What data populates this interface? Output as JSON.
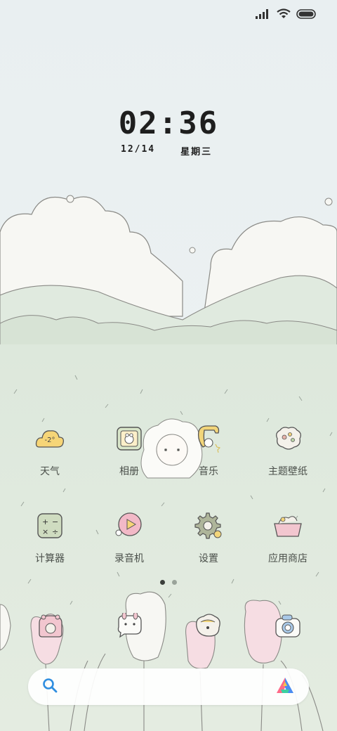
{
  "status_bar": {
    "signal_icon": "signal-bars-icon",
    "wifi_icon": "wifi-icon",
    "battery_icon": "battery-icon"
  },
  "lockscreen": {
    "time": "02:36",
    "date": "12/14",
    "weekday": "星期三"
  },
  "apps_row1": [
    {
      "label": "天气",
      "icon": "weather-cloud-icon",
      "temp": "-2°"
    },
    {
      "label": "相册",
      "icon": "gallery-icon"
    },
    {
      "label": "音乐",
      "icon": "music-icon"
    },
    {
      "label": "主题壁纸",
      "icon": "themes-icon"
    }
  ],
  "apps_row2": [
    {
      "label": "计算器",
      "icon": "calculator-icon"
    },
    {
      "label": "录音机",
      "icon": "recorder-icon"
    },
    {
      "label": "设置",
      "icon": "settings-gear-icon"
    },
    {
      "label": "应用商店",
      "icon": "app-store-icon"
    }
  ],
  "pagination": {
    "current": 1,
    "total": 2
  },
  "dock": [
    {
      "icon": "phone-icon"
    },
    {
      "icon": "messages-icon"
    },
    {
      "icon": "browser-icon"
    },
    {
      "icon": "camera-icon"
    }
  ],
  "search_bar": {
    "search_icon": "search-icon",
    "assistant_icon": "assistant-logo-icon"
  },
  "colors": {
    "sky": "#eef3f3",
    "grass": "#dfe9dc",
    "accent_blue": "#2f8ee0"
  }
}
